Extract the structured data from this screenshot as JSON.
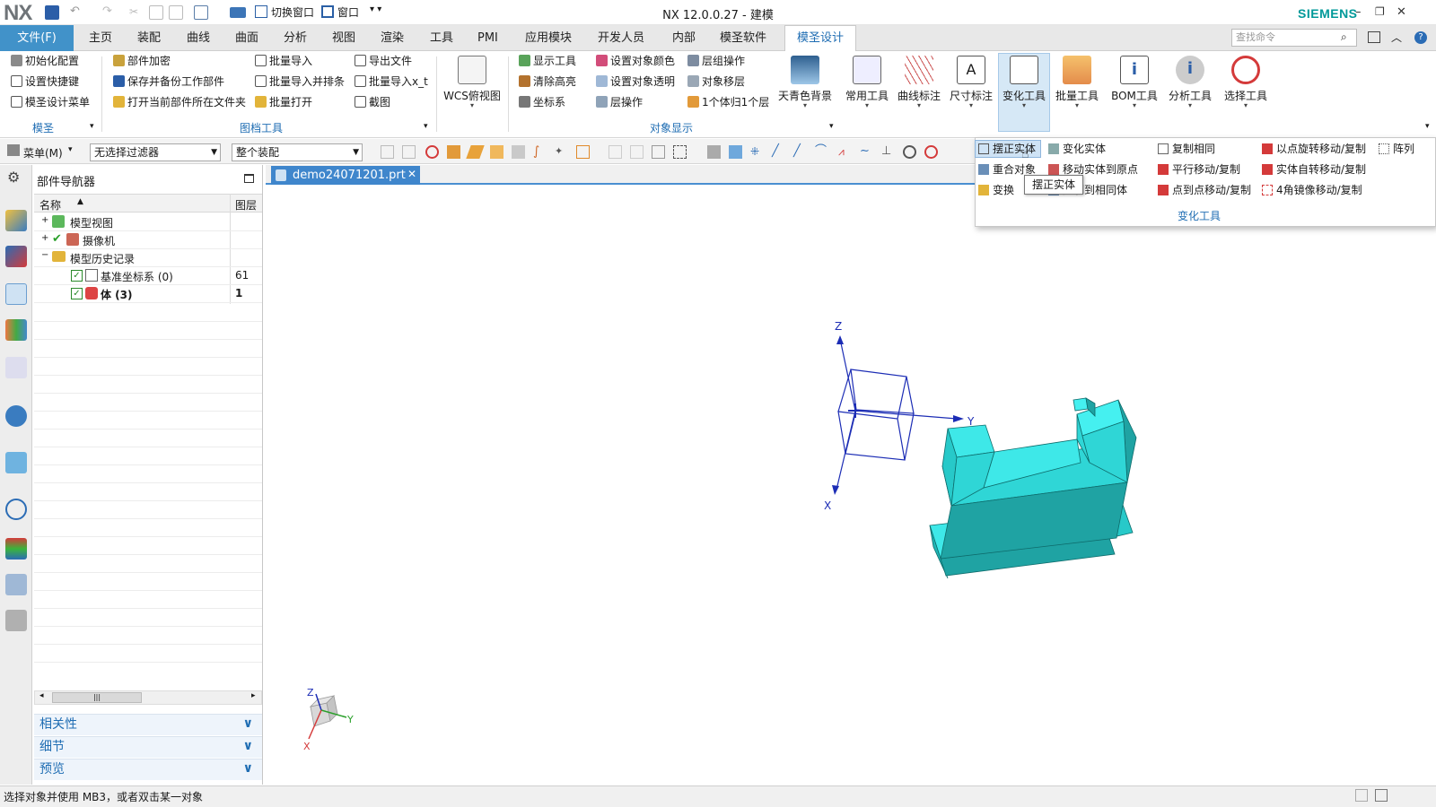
{
  "titlebar": {
    "logo": "NX",
    "switch_window": "切换窗口",
    "window_menu": "窗口",
    "title": "NX 12.0.0.27 - 建模",
    "brand": "SIEMENS"
  },
  "menubar": {
    "file": "文件(F)",
    "tabs": [
      "主页",
      "装配",
      "曲线",
      "曲面",
      "分析",
      "视图",
      "渲染",
      "工具",
      "PMI",
      "应用模块",
      "开发人员",
      "内部",
      "模圣软件"
    ],
    "active_tab": "模圣设计",
    "search_placeholder": "查找命令"
  },
  "ribbon": {
    "mold_group": {
      "items": [
        "初始化配置",
        "设置快捷键",
        "模圣设计菜单"
      ],
      "label": "模圣"
    },
    "doc_group": {
      "col1": [
        "部件加密",
        "保存并备份工作部件",
        "打开当前部件所在文件夹"
      ],
      "col2": [
        "批量导入",
        "批量导入并排条",
        "批量打开"
      ],
      "col3": [
        "导出文件",
        "批量导入x_t",
        "截图"
      ],
      "label": "图档工具"
    },
    "wcs": "WCS俯视图",
    "display_group": {
      "col1": [
        "显示工具",
        "清除高亮",
        "坐标系"
      ],
      "col2": [
        "设置对象颜色",
        "设置对象透明",
        "层操作"
      ],
      "col3": [
        "层组操作",
        "对象移层",
        "1个体归1个层"
      ],
      "label": "对象显示"
    },
    "big_buttons": [
      "天青色背景",
      "常用工具",
      "曲线标注",
      "尺寸标注",
      "变化工具",
      "批量工具",
      "BOM工具",
      "分析工具",
      "选择工具"
    ]
  },
  "toolbar2": {
    "menu": "菜单(M)",
    "filter": "无选择过滤器",
    "assembly": "整个装配"
  },
  "navigator": {
    "title": "部件导航器",
    "col_name": "名称",
    "col_layer": "图层",
    "rows": [
      {
        "name": "模型视图",
        "layer": ""
      },
      {
        "name": "摄像机",
        "layer": ""
      },
      {
        "name": "模型历史记录",
        "layer": ""
      },
      {
        "name": "基准坐标系 (0)",
        "layer": "61"
      },
      {
        "name": "体 (3)",
        "layer": "1"
      }
    ],
    "panels": [
      "相关性",
      "细节",
      "预览"
    ]
  },
  "document": {
    "tab": "demo24071201.prt"
  },
  "triad": {
    "z": "Z",
    "y": "Y",
    "x": "X"
  },
  "dropdown": {
    "col1": [
      "摆正实体",
      "重合对象",
      "变换"
    ],
    "col2": [
      "变化实体",
      "移动实体到原点",
      "复制到相同体"
    ],
    "col3": [
      "复制相同",
      "平行移动/复制",
      "点到点移动/复制"
    ],
    "col4": [
      "以点旋转移动/复制",
      "实体自转移动/复制",
      "4角镜像移动/复制"
    ],
    "col5": [
      "阵列"
    ],
    "group": "变化工具",
    "tooltip": "摆正实体"
  },
  "status": {
    "text": "选择对象并使用 MB3，或者双击某一对象"
  },
  "colors": {
    "accent": "#4192c9",
    "active_tab_text": "#1f6db3",
    "solid_top": "#3ee8e8",
    "solid_side": "#1fa3a3",
    "csys": "#1c2db5",
    "brand": "#009999"
  }
}
